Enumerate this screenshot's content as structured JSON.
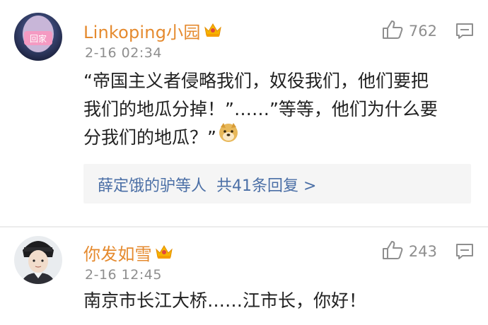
{
  "comments": [
    {
      "username": "Linkoping小园",
      "timestamp": "2-16 02:34",
      "likes": "762",
      "avatar_label": "回家",
      "body_lines": [
        "“帝国主义者侵略我们，奴役我们，他们要把",
        "我们的地瓜分掉！”……”等等，他们为什么要",
        "分我们的地瓜？”"
      ],
      "replies": {
        "users": "薛定饿的驴等人",
        "count_text": "共41条回复 >"
      }
    },
    {
      "username": "你发如雪",
      "timestamp": "2-16 12:45",
      "likes": "243",
      "body_lines": [
        "南京市长江大桥……江市长，你好！"
      ]
    }
  ],
  "icons": {
    "vip": "crown-icon",
    "like": "thumbs-up-icon",
    "reply": "comment-icon",
    "emoji": "doge-emoji-icon"
  },
  "colors": {
    "username": "#e58a2e",
    "reply_link": "#4b6fa6",
    "meta": "#8e8e8e",
    "reply_box": "#f5f5f5"
  }
}
